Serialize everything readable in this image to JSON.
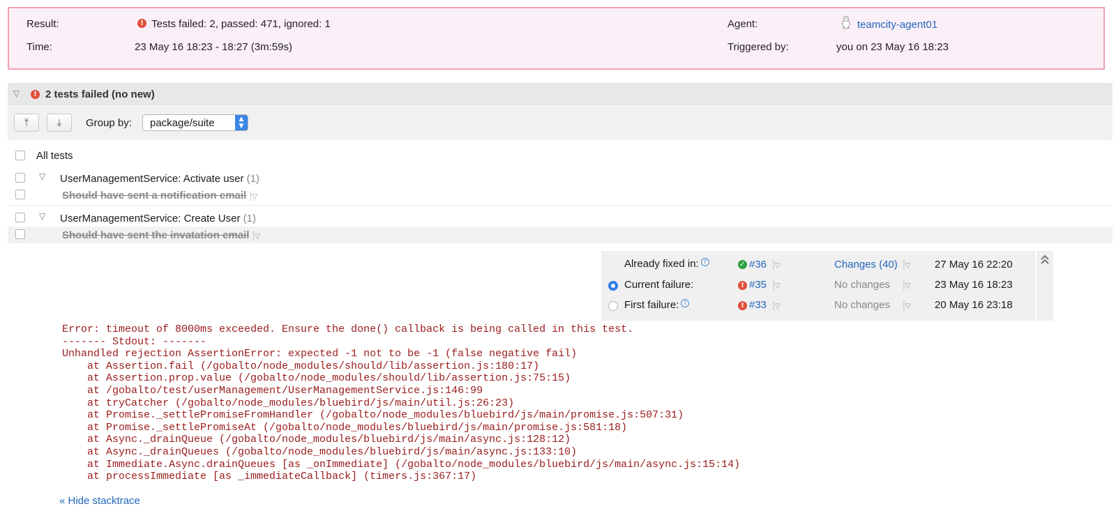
{
  "summary": {
    "result_label": "Result:",
    "result_value": "Tests failed: 2, passed: 471, ignored: 1",
    "time_label": "Time:",
    "time_value": "23 May 16 18:23 - 18:27 (3m:59s)",
    "agent_label": "Agent:",
    "agent_value": "teamcity-agent01",
    "triggered_label": "Triggered by:",
    "triggered_value": "you on 23 May 16 18:23"
  },
  "failed_section": {
    "title": "2 tests failed (no new)"
  },
  "toolbar": {
    "group_by_label": "Group by:",
    "group_by_value": "package/suite"
  },
  "tests": {
    "all_label": "All tests",
    "groups": [
      {
        "name": "UserManagementService: Activate user",
        "count": "(1)",
        "tests": [
          "Should have sent a notification email"
        ]
      },
      {
        "name": "UserManagementService: Create User",
        "count": "(1)",
        "tests": [
          "Should have sent the invatation email"
        ]
      }
    ]
  },
  "failure_panel": {
    "rows": [
      {
        "label": "Already fixed in:",
        "build": "#36",
        "status": "passed",
        "changes": "Changes (40)",
        "date": "27 May 16 22:20"
      },
      {
        "label": "Current failure:",
        "build": "#35",
        "status": "failed",
        "changes": "No changes",
        "date": "23 May 16 18:23"
      },
      {
        "label": "First failure:",
        "build": "#33",
        "status": "failed",
        "changes": "No changes",
        "date": "20 May 16 23:18"
      }
    ]
  },
  "stacktrace": {
    "text": "Error: timeout of 8000ms exceeded. Ensure the done() callback is being called in this test.\n------- Stdout: -------\nUnhandled rejection AssertionError: expected -1 not to be -1 (false negative fail)\n    at Assertion.fail (/gobalto/node_modules/should/lib/assertion.js:180:17)\n    at Assertion.prop.value (/gobalto/node_modules/should/lib/assertion.js:75:15)\n    at /gobalto/test/userManagement/UserManagementService.js:146:99\n    at tryCatcher (/gobalto/node_modules/bluebird/js/main/util.js:26:23)\n    at Promise._settlePromiseFromHandler (/gobalto/node_modules/bluebird/js/main/promise.js:507:31)\n    at Promise._settlePromiseAt (/gobalto/node_modules/bluebird/js/main/promise.js:581:18)\n    at Async._drainQueue (/gobalto/node_modules/bluebird/js/main/async.js:128:12)\n    at Async._drainQueues (/gobalto/node_modules/bluebird/js/main/async.js:133:10)\n    at Immediate.Async.drainQueues [as _onImmediate] (/gobalto/node_modules/bluebird/js/main/async.js:15:14)\n    at processImmediate [as _immediateCallback] (timers.js:367:17)",
    "hide_link": "« Hide stacktrace"
  },
  "colors": {
    "summary_bg": "#fcf0f8",
    "summary_border": "#f0a3ad",
    "error_red": "#e0503c",
    "success_green": "#2ea043",
    "link_blue": "#2266bb",
    "stacktrace_red": "#9a1b1b"
  },
  "icons": {
    "error": "error-circle-icon",
    "success": "check-circle-icon",
    "agent": "linux-penguin-icon",
    "collapse": "double-chevron-up-icon",
    "expand_all": "expand-all-icon",
    "collapse_all": "collapse-all-icon"
  }
}
